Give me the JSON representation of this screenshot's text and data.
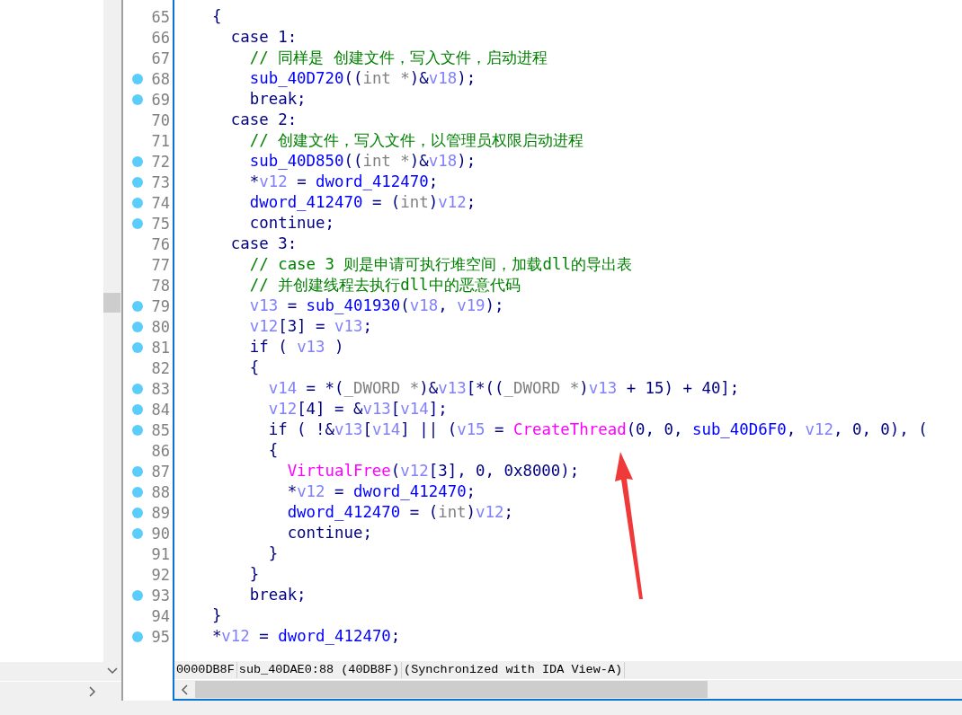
{
  "pseudocode": {
    "lines": [
      {
        "number": "65",
        "breakpoint": false,
        "tokens": [
          {
            "kind": "k",
            "text": "    {"
          }
        ]
      },
      {
        "number": "66",
        "breakpoint": false,
        "tokens": [
          {
            "kind": "k",
            "text": "      case 1:"
          }
        ]
      },
      {
        "number": "67",
        "breakpoint": false,
        "tokens": [
          {
            "kind": "c",
            "text": "        // 同样是 创建文件，写入文件，启动进程"
          }
        ]
      },
      {
        "number": "68",
        "breakpoint": true,
        "tokens": [
          {
            "kind": "f",
            "text": "        sub_40D720"
          },
          {
            "kind": "k",
            "text": "(("
          },
          {
            "kind": "t",
            "text": "int *"
          },
          {
            "kind": "k",
            "text": ")&"
          },
          {
            "kind": "v",
            "text": "v18"
          },
          {
            "kind": "k",
            "text": ");"
          }
        ]
      },
      {
        "number": "69",
        "breakpoint": true,
        "tokens": [
          {
            "kind": "k",
            "text": "        break;"
          }
        ]
      },
      {
        "number": "70",
        "breakpoint": false,
        "tokens": [
          {
            "kind": "k",
            "text": "      case 2:"
          }
        ]
      },
      {
        "number": "71",
        "breakpoint": false,
        "tokens": [
          {
            "kind": "c",
            "text": "        // 创建文件，写入文件，以管理员权限启动进程"
          }
        ]
      },
      {
        "number": "72",
        "breakpoint": true,
        "tokens": [
          {
            "kind": "f",
            "text": "        sub_40D850"
          },
          {
            "kind": "k",
            "text": "(("
          },
          {
            "kind": "t",
            "text": "int *"
          },
          {
            "kind": "k",
            "text": ")&"
          },
          {
            "kind": "v",
            "text": "v18"
          },
          {
            "kind": "k",
            "text": ");"
          }
        ]
      },
      {
        "number": "73",
        "breakpoint": true,
        "tokens": [
          {
            "kind": "k",
            "text": "        *"
          },
          {
            "kind": "v",
            "text": "v12"
          },
          {
            "kind": "k",
            "text": " = "
          },
          {
            "kind": "f",
            "text": "dword_412470"
          },
          {
            "kind": "k",
            "text": ";"
          }
        ]
      },
      {
        "number": "74",
        "breakpoint": true,
        "tokens": [
          {
            "kind": "f",
            "text": "        dword_412470"
          },
          {
            "kind": "k",
            "text": " = ("
          },
          {
            "kind": "t",
            "text": "int"
          },
          {
            "kind": "k",
            "text": ")"
          },
          {
            "kind": "v",
            "text": "v12"
          },
          {
            "kind": "k",
            "text": ";"
          }
        ]
      },
      {
        "number": "75",
        "breakpoint": true,
        "tokens": [
          {
            "kind": "k",
            "text": "        continue;"
          }
        ]
      },
      {
        "number": "76",
        "breakpoint": false,
        "tokens": [
          {
            "kind": "k",
            "text": "      case 3:"
          }
        ]
      },
      {
        "number": "77",
        "breakpoint": false,
        "tokens": [
          {
            "kind": "c",
            "text": "        // case 3 则是申请可执行堆空间，加载dll的导出表"
          }
        ]
      },
      {
        "number": "78",
        "breakpoint": false,
        "tokens": [
          {
            "kind": "c",
            "text": "        // 并创建线程去执行dll中的恶意代码"
          }
        ]
      },
      {
        "number": "79",
        "breakpoint": true,
        "tokens": [
          {
            "kind": "v",
            "text": "        v13"
          },
          {
            "kind": "k",
            "text": " = "
          },
          {
            "kind": "f",
            "text": "sub_401930"
          },
          {
            "kind": "k",
            "text": "("
          },
          {
            "kind": "v",
            "text": "v18"
          },
          {
            "kind": "k",
            "text": ", "
          },
          {
            "kind": "v",
            "text": "v19"
          },
          {
            "kind": "k",
            "text": ");"
          }
        ]
      },
      {
        "number": "80",
        "breakpoint": true,
        "tokens": [
          {
            "kind": "v",
            "text": "        v12"
          },
          {
            "kind": "k",
            "text": "[3] = "
          },
          {
            "kind": "v",
            "text": "v13"
          },
          {
            "kind": "k",
            "text": ";"
          }
        ]
      },
      {
        "number": "81",
        "breakpoint": true,
        "tokens": [
          {
            "kind": "k",
            "text": "        if ( "
          },
          {
            "kind": "v",
            "text": "v13"
          },
          {
            "kind": "k",
            "text": " )"
          }
        ]
      },
      {
        "number": "82",
        "breakpoint": false,
        "tokens": [
          {
            "kind": "k",
            "text": "        {"
          }
        ]
      },
      {
        "number": "83",
        "breakpoint": true,
        "tokens": [
          {
            "kind": "v",
            "text": "          v14"
          },
          {
            "kind": "k",
            "text": " = *("
          },
          {
            "kind": "t",
            "text": "_DWORD *"
          },
          {
            "kind": "k",
            "text": ")&"
          },
          {
            "kind": "v",
            "text": "v13"
          },
          {
            "kind": "k",
            "text": "[*(("
          },
          {
            "kind": "t",
            "text": "_DWORD *"
          },
          {
            "kind": "k",
            "text": ")"
          },
          {
            "kind": "v",
            "text": "v13"
          },
          {
            "kind": "k",
            "text": " + 15) + 40];"
          }
        ]
      },
      {
        "number": "84",
        "breakpoint": true,
        "tokens": [
          {
            "kind": "v",
            "text": "          v12"
          },
          {
            "kind": "k",
            "text": "[4] = &"
          },
          {
            "kind": "v",
            "text": "v13"
          },
          {
            "kind": "k",
            "text": "["
          },
          {
            "kind": "v",
            "text": "v14"
          },
          {
            "kind": "k",
            "text": "];"
          }
        ]
      },
      {
        "number": "85",
        "breakpoint": true,
        "tokens": [
          {
            "kind": "k",
            "text": "          if ( !&"
          },
          {
            "kind": "v",
            "text": "v13"
          },
          {
            "kind": "k",
            "text": "["
          },
          {
            "kind": "v",
            "text": "v14"
          },
          {
            "kind": "k",
            "text": "] || ("
          },
          {
            "kind": "v",
            "text": "v15"
          },
          {
            "kind": "k",
            "text": " = "
          },
          {
            "kind": "a",
            "text": "CreateThread"
          },
          {
            "kind": "k",
            "text": "(0, 0, "
          },
          {
            "kind": "f",
            "text": "sub_40D6F0"
          },
          {
            "kind": "k",
            "text": ", "
          },
          {
            "kind": "v",
            "text": "v12"
          },
          {
            "kind": "k",
            "text": ", 0, 0), ("
          }
        ]
      },
      {
        "number": "86",
        "breakpoint": false,
        "tokens": [
          {
            "kind": "k",
            "text": "          {"
          }
        ]
      },
      {
        "number": "87",
        "breakpoint": true,
        "tokens": [
          {
            "kind": "a",
            "text": "            VirtualFree"
          },
          {
            "kind": "k",
            "text": "("
          },
          {
            "kind": "v",
            "text": "v12"
          },
          {
            "kind": "k",
            "text": "[3], 0, 0x8000);"
          }
        ]
      },
      {
        "number": "88",
        "breakpoint": true,
        "tokens": [
          {
            "kind": "k",
            "text": "            *"
          },
          {
            "kind": "v",
            "text": "v12"
          },
          {
            "kind": "k",
            "text": " = "
          },
          {
            "kind": "f",
            "text": "dword_412470"
          },
          {
            "kind": "k",
            "text": ";"
          }
        ]
      },
      {
        "number": "89",
        "breakpoint": true,
        "tokens": [
          {
            "kind": "f",
            "text": "            dword_412470"
          },
          {
            "kind": "k",
            "text": " = ("
          },
          {
            "kind": "t",
            "text": "int"
          },
          {
            "kind": "k",
            "text": ")"
          },
          {
            "kind": "v",
            "text": "v12"
          },
          {
            "kind": "k",
            "text": ";"
          }
        ]
      },
      {
        "number": "90",
        "breakpoint": true,
        "tokens": [
          {
            "kind": "k",
            "text": "            continue;"
          }
        ]
      },
      {
        "number": "91",
        "breakpoint": false,
        "tokens": [
          {
            "kind": "k",
            "text": "          }"
          }
        ]
      },
      {
        "number": "92",
        "breakpoint": false,
        "tokens": [
          {
            "kind": "k",
            "text": "        }"
          }
        ]
      },
      {
        "number": "93",
        "breakpoint": true,
        "tokens": [
          {
            "kind": "k",
            "text": "        break;"
          }
        ]
      },
      {
        "number": "94",
        "breakpoint": false,
        "tokens": [
          {
            "kind": "k",
            "text": "    }"
          }
        ]
      },
      {
        "number": "95",
        "breakpoint": true,
        "tokens": [
          {
            "kind": "k",
            "text": "    *"
          },
          {
            "kind": "v",
            "text": "v12"
          },
          {
            "kind": "k",
            "text": " = "
          },
          {
            "kind": "f",
            "text": "dword_412470"
          },
          {
            "kind": "k",
            "text": ";"
          }
        ]
      }
    ]
  },
  "status_bar": {
    "fields": [
      "0000DB8F",
      "sub_40DAE0:88 (40DB8F)",
      "(Synchronized with IDA View-A)"
    ]
  }
}
